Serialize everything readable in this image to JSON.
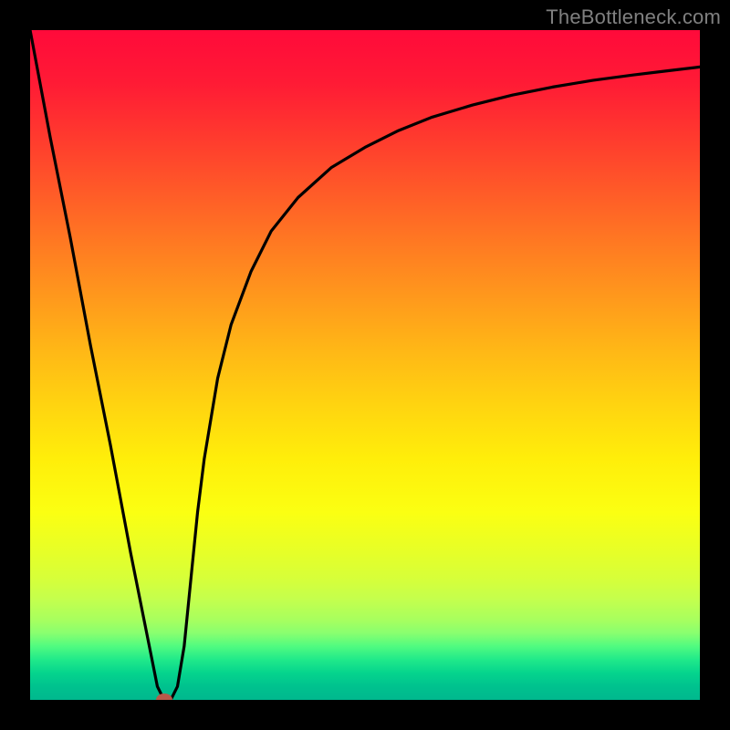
{
  "watermark": "TheBottleneck.com",
  "chart_data": {
    "type": "line",
    "title": "",
    "xlabel": "",
    "ylabel": "",
    "xlim": [
      0,
      100
    ],
    "ylim": [
      0,
      100
    ],
    "grid": false,
    "series": [
      {
        "name": "curve",
        "color": "#000000",
        "x": [
          0,
          3,
          6,
          9,
          12,
          15,
          17,
          18,
          19,
          20,
          21,
          22,
          23,
          24,
          25,
          26,
          28,
          30,
          33,
          36,
          40,
          45,
          50,
          55,
          60,
          66,
          72,
          78,
          84,
          90,
          95,
          100
        ],
        "y": [
          100,
          84,
          69,
          53,
          38,
          22,
          12,
          7,
          2,
          0,
          0,
          2,
          8,
          18,
          28,
          36,
          48,
          56,
          64,
          70,
          75,
          79.5,
          82.5,
          85,
          87,
          88.8,
          90.3,
          91.5,
          92.5,
          93.3,
          93.9,
          94.5
        ]
      }
    ],
    "marker": {
      "x": 20,
      "y": 0,
      "color": "#b85a4a"
    },
    "background_gradient": {
      "top": "#ff0a3a",
      "mid": "#ffee0a",
      "bottom": "#00b88e"
    }
  }
}
